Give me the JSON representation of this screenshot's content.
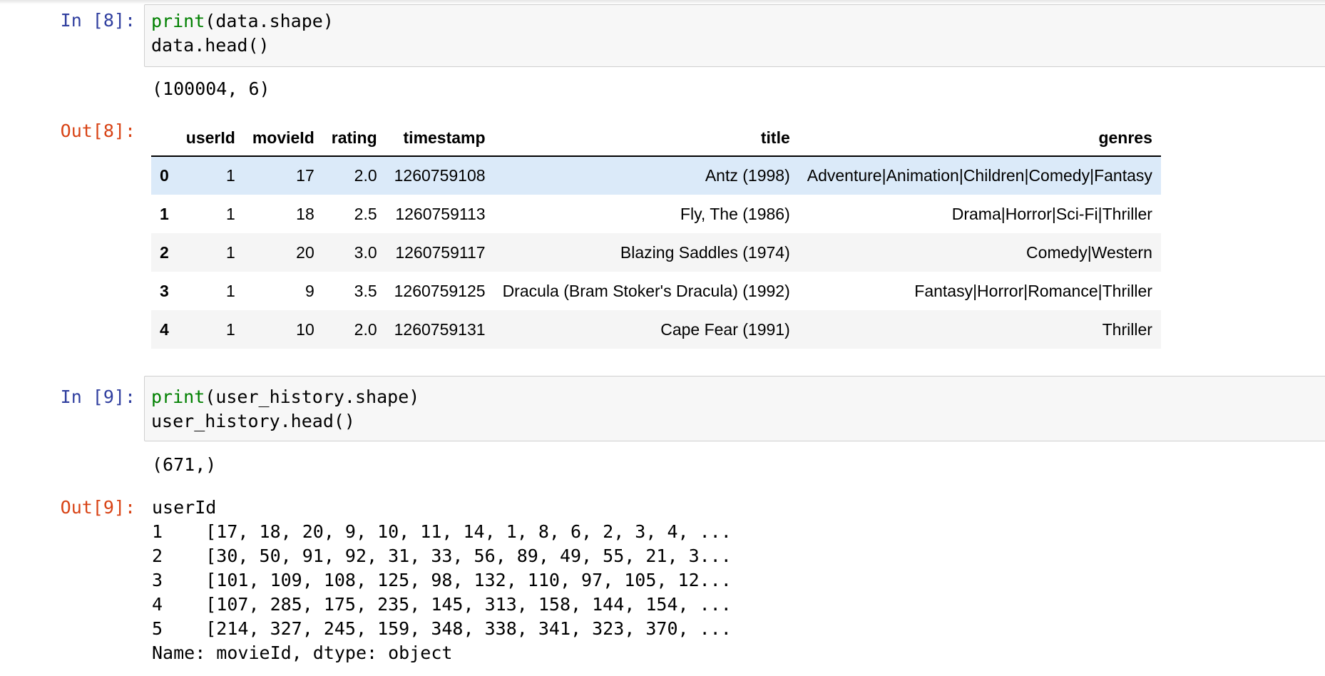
{
  "cells": [
    {
      "in_prompt": "In [8]:",
      "code": [
        {
          "fn": "print",
          "rest": "(data.shape)"
        },
        {
          "fn": "",
          "rest": "data.head()"
        }
      ],
      "stdout": "(100004, 6)",
      "out_prompt": "Out[8]:",
      "table": {
        "columns": [
          "",
          "userId",
          "movieId",
          "rating",
          "timestamp",
          "title",
          "genres"
        ],
        "rows": [
          [
            "0",
            "1",
            "17",
            "2.0",
            "1260759108",
            "Antz (1998)",
            "Adventure|Animation|Children|Comedy|Fantasy"
          ],
          [
            "1",
            "1",
            "18",
            "2.5",
            "1260759113",
            "Fly, The (1986)",
            "Drama|Horror|Sci-Fi|Thriller"
          ],
          [
            "2",
            "1",
            "20",
            "3.0",
            "1260759117",
            "Blazing Saddles (1974)",
            "Comedy|Western"
          ],
          [
            "3",
            "1",
            "9",
            "3.5",
            "1260759125",
            "Dracula (Bram Stoker's Dracula) (1992)",
            "Fantasy|Horror|Romance|Thriller"
          ],
          [
            "4",
            "1",
            "10",
            "2.0",
            "1260759131",
            "Cape Fear (1991)",
            "Thriller"
          ]
        ]
      }
    },
    {
      "in_prompt": "In [9]:",
      "code": [
        {
          "fn": "print",
          "rest": "(user_history.shape)"
        },
        {
          "fn": "",
          "rest": "user_history.head()"
        }
      ],
      "stdout": "(671,)",
      "out_prompt": "Out[9]:",
      "series_output": [
        "userId",
        "1    [17, 18, 20, 9, 10, 11, 14, 1, 8, 6, 2, 3, 4, ...",
        "2    [30, 50, 91, 92, 31, 33, 56, 89, 49, 55, 21, 3...",
        "3    [101, 109, 108, 125, 98, 132, 110, 97, 105, 12...",
        "4    [107, 285, 175, 235, 145, 313, 158, 144, 154, ...",
        "5    [214, 327, 245, 159, 348, 338, 341, 323, 370, ...",
        "Name: movieId, dtype: object"
      ]
    }
  ],
  "colors": {
    "in_prompt": "#303F9F",
    "out_prompt": "#D84315",
    "builtin": "#008000",
    "hover_row": "#dbeaf9"
  }
}
